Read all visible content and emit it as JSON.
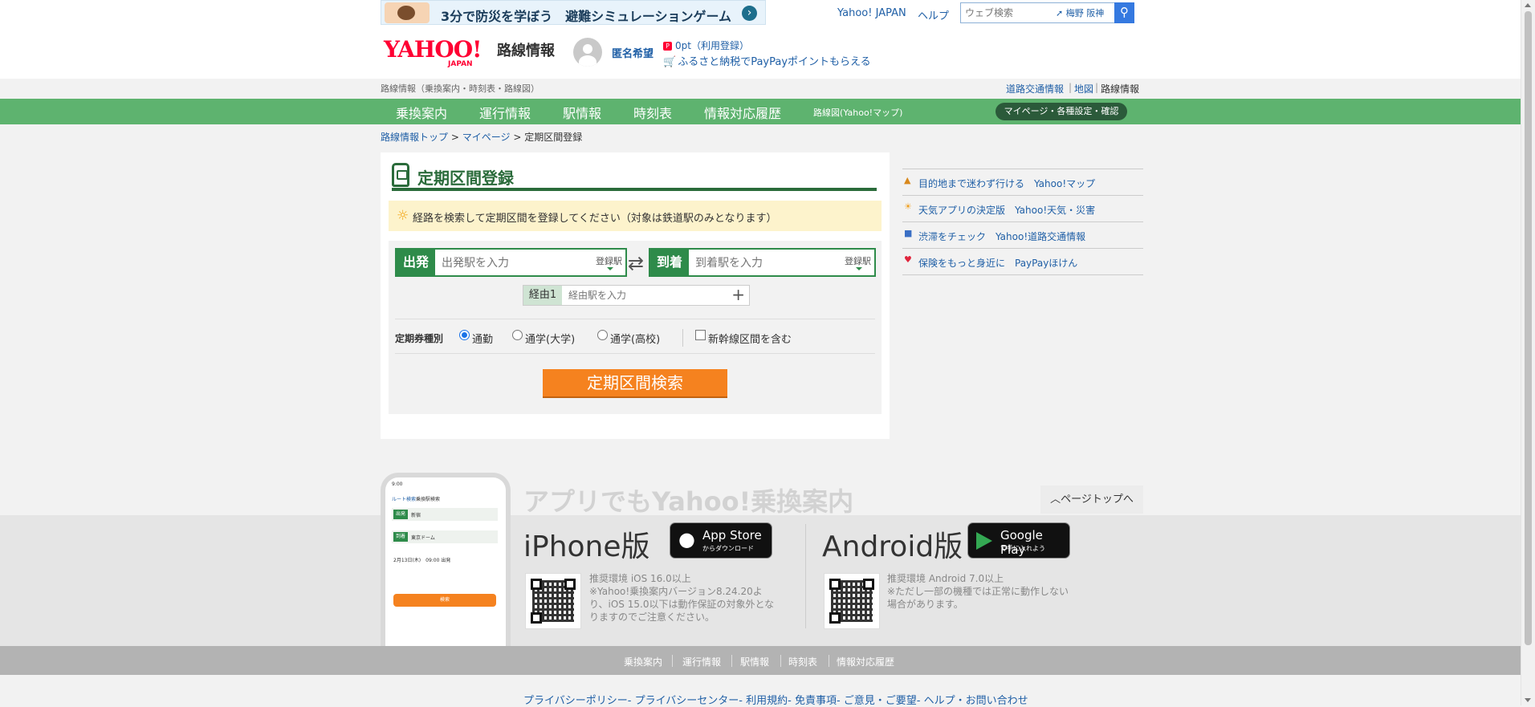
{
  "banner": {
    "text": "3分で防災を学ぼう　避難シミュレーションゲーム"
  },
  "header": {
    "yahoo_japan": "Yahoo! JAPAN",
    "help": "ヘルプ",
    "search_placeholder": "ウェブ検索",
    "location": "梅野 阪神",
    "logo_text": "YAHOO!",
    "logo_sub": "JAPAN",
    "brand": "路線情報",
    "username": "匿名希望",
    "points": "0pt（利用登録）",
    "furusato": "ふるさと納税でPayPayポイントもらえる"
  },
  "subheader": {
    "subtitle": "路線情報（乗換案内・時刻表・路線図）",
    "links": [
      "道路交通情報",
      "地図",
      "路線情報"
    ]
  },
  "nav": {
    "items": [
      "乗換案内",
      "運行情報",
      "駅情報",
      "時刻表",
      "情報対応履歴"
    ],
    "map": "路線図(Yahoo!マップ)",
    "mypage": "マイページ・各種設定・確認"
  },
  "breadcrumb": {
    "top": "路線情報トップ",
    "mypage": "マイページ",
    "current": "定期区間登録",
    "sep": ">"
  },
  "panel": {
    "title": "定期区間登録",
    "notice": "経路を検索して定期区間を登録してください（対象は鉄道駅のみとなります）",
    "from_label": "出発",
    "from_placeholder": "出発駅を入力",
    "to_label": "到着",
    "to_placeholder": "到着駅を入力",
    "registered": "登録駅",
    "via_label": "経由1",
    "via_placeholder": "経由駅を入力",
    "pass_type_label": "定期券種別",
    "options": [
      "通勤",
      "通学(大学)",
      "通学(高校)"
    ],
    "selected_option": "通勤",
    "shinkansen": "新幹線区間を含む",
    "search_button": "定期区間検索"
  },
  "side_links": [
    {
      "icon": "map-icon",
      "text": "目的地まで迷わず行ける　Yahoo!マップ"
    },
    {
      "icon": "weather-icon",
      "text": "天気アプリの決定版　Yahoo!天気・災害"
    },
    {
      "icon": "car-icon",
      "text": "渋滞をチェック　Yahoo!道路交通情報"
    },
    {
      "icon": "heart-icon",
      "text": "保険をもっと身近に　PayPayほけん"
    }
  ],
  "app": {
    "heading": "アプリでもYahoo!乗換案内",
    "page_top": "ページトップへ",
    "iphone": "iPhone版",
    "appstore_big": "App Store",
    "appstore_small": "からダウンロード",
    "ios_req": "推奨環境 iOS 16.0以上",
    "ios_note1": "※Yahoo!乗換案内バージョン8.24.20よ",
    "ios_note2": "り、iOS 15.0以下は動作保証の対象外とな",
    "ios_note3": "りますのでご注意ください。",
    "android": "Android版",
    "gplay_big": "Google Play",
    "gplay_small": "で手に入れよう",
    "android_req": "推奨環境 Android 7.0以上",
    "android_note1": "※ただし一部の機種では正常に動作しない",
    "android_note2": "場合があります。",
    "phone": {
      "time": "9:00",
      "tab1": "ルート検索",
      "tab2": "乗換駅検索",
      "from_tag": "出発",
      "from": "新宿",
      "to_tag": "到着",
      "to": "東京ドーム",
      "date": "2月13日(木)　09:00 出発",
      "button": "検索"
    }
  },
  "footer": {
    "nav": [
      "乗換案内",
      "運行情報",
      "駅情報",
      "時刻表",
      "情報対応履歴"
    ],
    "links": "プライバシーポリシー- プライバシーセンター- 利用規約- 免責事項- ご意見・ご要望- ヘルプ・お問い合わせ"
  },
  "colors": {
    "nav_green": "#5eb36f",
    "title_green": "#2a6b3a",
    "search_orange": "#f5821f",
    "link_blue": "#1f5fa6"
  }
}
